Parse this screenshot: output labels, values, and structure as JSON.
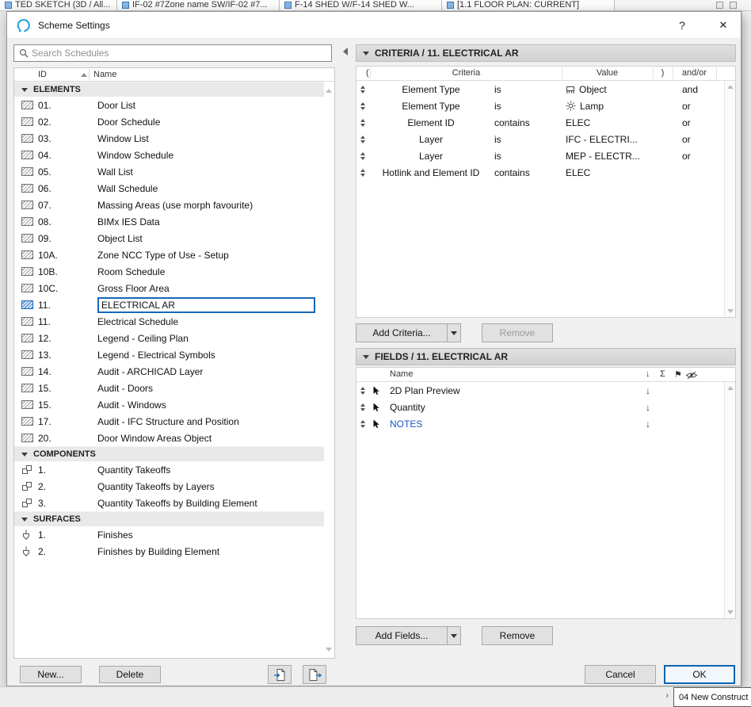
{
  "background": {
    "tabs": [
      {
        "label": "TED SKETCH (3D / All..."
      },
      {
        "label": "IF-02 #7Zone name SW/IF-02 #7..."
      },
      {
        "label": "F-14 SHED W/F-14 SHED W..."
      },
      {
        "label": "[1.1 FLOOR PLAN: CURRENT]"
      }
    ],
    "status_right": "04 New Construct"
  },
  "dialog": {
    "title": "Scheme Settings",
    "help_icon": "?",
    "close_icon": "✕",
    "search": {
      "placeholder": "Search Schedules"
    },
    "left": {
      "columns": {
        "id": "ID",
        "name": "Name"
      },
      "groups": [
        {
          "label": "ELEMENTS",
          "icon": "schedule-icon",
          "items": [
            {
              "id": "01.",
              "name": "Door List"
            },
            {
              "id": "02.",
              "name": "Door Schedule"
            },
            {
              "id": "03.",
              "name": "Window List"
            },
            {
              "id": "04.",
              "name": "Window Schedule"
            },
            {
              "id": "05.",
              "name": "Wall List"
            },
            {
              "id": "06.",
              "name": "Wall Schedule"
            },
            {
              "id": "07.",
              "name": "Massing Areas (use morph favourite)"
            },
            {
              "id": "08.",
              "name": "BIMx IES Data"
            },
            {
              "id": "09.",
              "name": "Object List"
            },
            {
              "id": "10A.",
              "name": "Zone NCC Type of Use - Setup"
            },
            {
              "id": "10B.",
              "name": "Room Schedule"
            },
            {
              "id": "10C.",
              "name": "Gross Floor Area"
            },
            {
              "id": "11.",
              "name": "ELECTRICAL AR",
              "selected": true,
              "editing": true
            },
            {
              "id": "11.",
              "name": "Electrical Schedule"
            },
            {
              "id": "12.",
              "name": "Legend - Ceiling Plan"
            },
            {
              "id": "13.",
              "name": "Legend - Electrical Symbols"
            },
            {
              "id": "14.",
              "name": "Audit - ARCHICAD Layer"
            },
            {
              "id": "15.",
              "name": "Audit - Doors"
            },
            {
              "id": "15.",
              "name": "Audit - Windows"
            },
            {
              "id": "17.",
              "name": "Audit - IFC Structure and Position"
            },
            {
              "id": "20.",
              "name": "Door Window Areas Object"
            }
          ]
        },
        {
          "label": "COMPONENTS",
          "icon": "component-icon",
          "items": [
            {
              "id": "1.",
              "name": "Quantity Takeoffs"
            },
            {
              "id": "2.",
              "name": "Quantity Takeoffs by Layers"
            },
            {
              "id": "3.",
              "name": "Quantity Takeoffs by Building Element"
            }
          ]
        },
        {
          "label": "SURFACES",
          "icon": "surface-icon",
          "items": [
            {
              "id": "1.",
              "name": "Finishes"
            },
            {
              "id": "2.",
              "name": "Finishes by Building Element"
            }
          ]
        }
      ],
      "new_button": "New...",
      "delete_button": "Delete"
    },
    "criteria": {
      "header": "CRITERIA / 11. ELECTRICAL AR",
      "columns": {
        "open": "(",
        "criteria": "Criteria",
        "value": "Value",
        "close": ")",
        "andor": "and/or"
      },
      "rows": [
        {
          "criteria": "Element Type",
          "operator": "is",
          "value": "Object",
          "value_icon": "object-icon",
          "andor": "and"
        },
        {
          "criteria": "Element Type",
          "operator": "is",
          "value": "Lamp",
          "value_icon": "lamp-icon",
          "andor": "or"
        },
        {
          "criteria": "Element ID",
          "operator": "contains",
          "value": "ELEC",
          "andor": "or"
        },
        {
          "criteria": "Layer",
          "operator": "is",
          "value": "IFC - ELECTRI...",
          "andor": "or"
        },
        {
          "criteria": "Layer",
          "operator": "is",
          "value": "MEP - ELECTR...",
          "andor": "or"
        },
        {
          "criteria": "Hotlink and Element ID",
          "operator": "contains",
          "value": "ELEC",
          "andor": ""
        }
      ],
      "add_button": "Add Criteria...",
      "remove_button": "Remove"
    },
    "fields": {
      "header": "FIELDS / 11. ELECTRICAL AR",
      "name_column": "Name",
      "sort_arrow": "↓",
      "sum_symbol": "Σ",
      "flag_symbol": "⚑",
      "rows": [
        {
          "name": "2D Plan Preview"
        },
        {
          "name": "Quantity"
        },
        {
          "name": "NOTES",
          "highlight": true
        }
      ],
      "add_button": "Add Fields...",
      "remove_button": "Remove"
    },
    "footer": {
      "cancel": "Cancel",
      "ok": "OK"
    }
  },
  "colors": {
    "accent_blue": "#1668b8",
    "notes_blue": "#1a54c8",
    "archicad_teal": "#29a8e0"
  }
}
